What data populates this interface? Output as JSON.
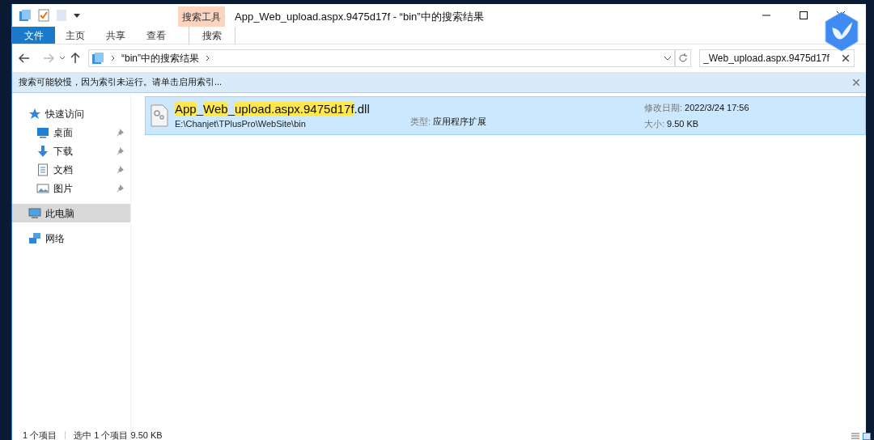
{
  "window": {
    "title": "App_Web_upload.aspx.9475d17f - “bin”中的搜索结果",
    "context_tab_group": "搜索工具"
  },
  "ribbon_tabs": [
    {
      "label": "文件",
      "kind": "file",
      "selected": false
    },
    {
      "label": "主页",
      "kind": "tab",
      "selected": false
    },
    {
      "label": "共享",
      "kind": "tab",
      "selected": false
    },
    {
      "label": "查看",
      "kind": "tab",
      "selected": false
    },
    {
      "label": "搜索",
      "kind": "context",
      "selected": true
    }
  ],
  "address_bar": {
    "crumbs": [
      "“bin”中的搜索结果"
    ]
  },
  "search": {
    "value": "_Web_upload.aspx.9475d17f"
  },
  "info_bar": {
    "text": "搜索可能较慢，因为索引未运行。请单击启用索引..."
  },
  "sidebar": {
    "items": [
      {
        "label": "快速访问",
        "kind": "star",
        "selected": false,
        "children": [
          {
            "label": "桌面",
            "kind": "desktop",
            "pinned": true,
            "selected": false
          },
          {
            "label": "下载",
            "kind": "download",
            "pinned": true,
            "selected": false
          },
          {
            "label": "文档",
            "kind": "document",
            "pinned": true,
            "selected": false
          },
          {
            "label": "图片",
            "kind": "pictures",
            "pinned": true,
            "selected": false
          }
        ]
      },
      {
        "label": "此电脑",
        "kind": "computer",
        "selected": true
      },
      {
        "label": "网络",
        "kind": "network",
        "selected": false
      }
    ]
  },
  "results": [
    {
      "selected": true,
      "name": [
        {
          "text": "App",
          "highlighted": true
        },
        {
          "text": "_",
          "highlighted": false
        },
        {
          "text": "Web",
          "highlighted": true
        },
        {
          "text": "_",
          "highlighted": false
        },
        {
          "text": "upload.aspx.9475d17f",
          "highlighted": true
        },
        {
          "text": ".dll",
          "highlighted": false
        }
      ],
      "path": "E:\\Chanjet\\TPlusPro\\WebSite\\bin",
      "type_label": "类型:",
      "type_value": "应用程序扩展",
      "date_label": "修改日期:",
      "date_value": "2022/3/24 17:56",
      "size_label": "大小:",
      "size_value": "9.50 KB"
    }
  ],
  "status_bar": {
    "items": [
      "1 个项目",
      "选中 1 个项目 9.50 KB"
    ]
  }
}
